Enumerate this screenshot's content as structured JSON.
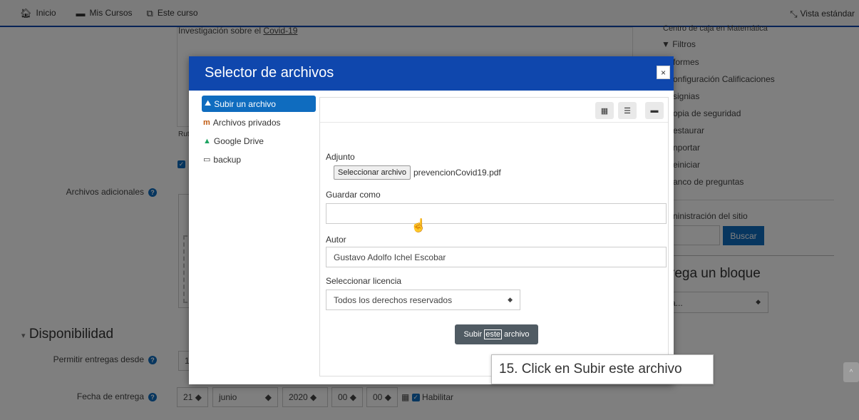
{
  "navbar": {
    "home": "Inicio",
    "courses": "Mis Cursos",
    "this_course": "Este curso",
    "view": "Vista estándar"
  },
  "background": {
    "editor_text_prefix": "Investigación sobre el ",
    "editor_text_link": "Covid-19",
    "path_label": "Rut",
    "extra_files_label": "Archivos adicionales",
    "availability_title": "Disponibilidad",
    "allow_from_label": "Permitir entregas desde",
    "allow_from_value": "1",
    "due_date_label": "Fecha de entrega",
    "due_day": "21",
    "due_month": "junio",
    "due_year": "2020",
    "due_hour": "00",
    "due_minute": "00",
    "enable_label": "Habilitar"
  },
  "right_menu": {
    "top_cut": "Centro de caja en Matemática",
    "items": [
      "Filtros",
      "formes",
      "onfiguración Calificaciones",
      "signias",
      "opia de seguridad",
      "estaurar",
      "nportar",
      "einiciar",
      "anco de preguntas"
    ],
    "admin": "ninistración del sitio",
    "search_button": "Buscar",
    "add_block_title": "rega un bloque",
    "add_block_select": "a..."
  },
  "modal": {
    "title": "Selector de archivos",
    "close": "×",
    "repositories": [
      {
        "icon": "upload-icon",
        "label": "Subir un archivo",
        "active": true
      },
      {
        "icon": "private-files-icon",
        "label": "Archivos privados",
        "active": false
      },
      {
        "icon": "google-drive-icon",
        "label": "Google Drive",
        "active": false
      },
      {
        "icon": "backup-icon",
        "label": "backup",
        "active": false
      }
    ],
    "attachment_label": "Adjunto",
    "select_file_button": "Seleccionar archivo",
    "selected_file": "prevencionCovid19.pdf",
    "save_as_label": "Guardar como",
    "save_as_value": "",
    "author_label": "Autor",
    "author_value": "Gustavo Adolfo Ichel Escobar",
    "license_label": "Seleccionar licencia",
    "license_value": "Todos los derechos reservados",
    "upload_button_pre": "Subir ",
    "upload_button_hl": "este",
    "upload_button_post": " archivo"
  },
  "tooltip": {
    "text": "15. Click en Subir este archivo"
  },
  "colors": {
    "brand": "#0f47ad",
    "primary": "#0f6cbf",
    "upload_button": "#505b63"
  }
}
